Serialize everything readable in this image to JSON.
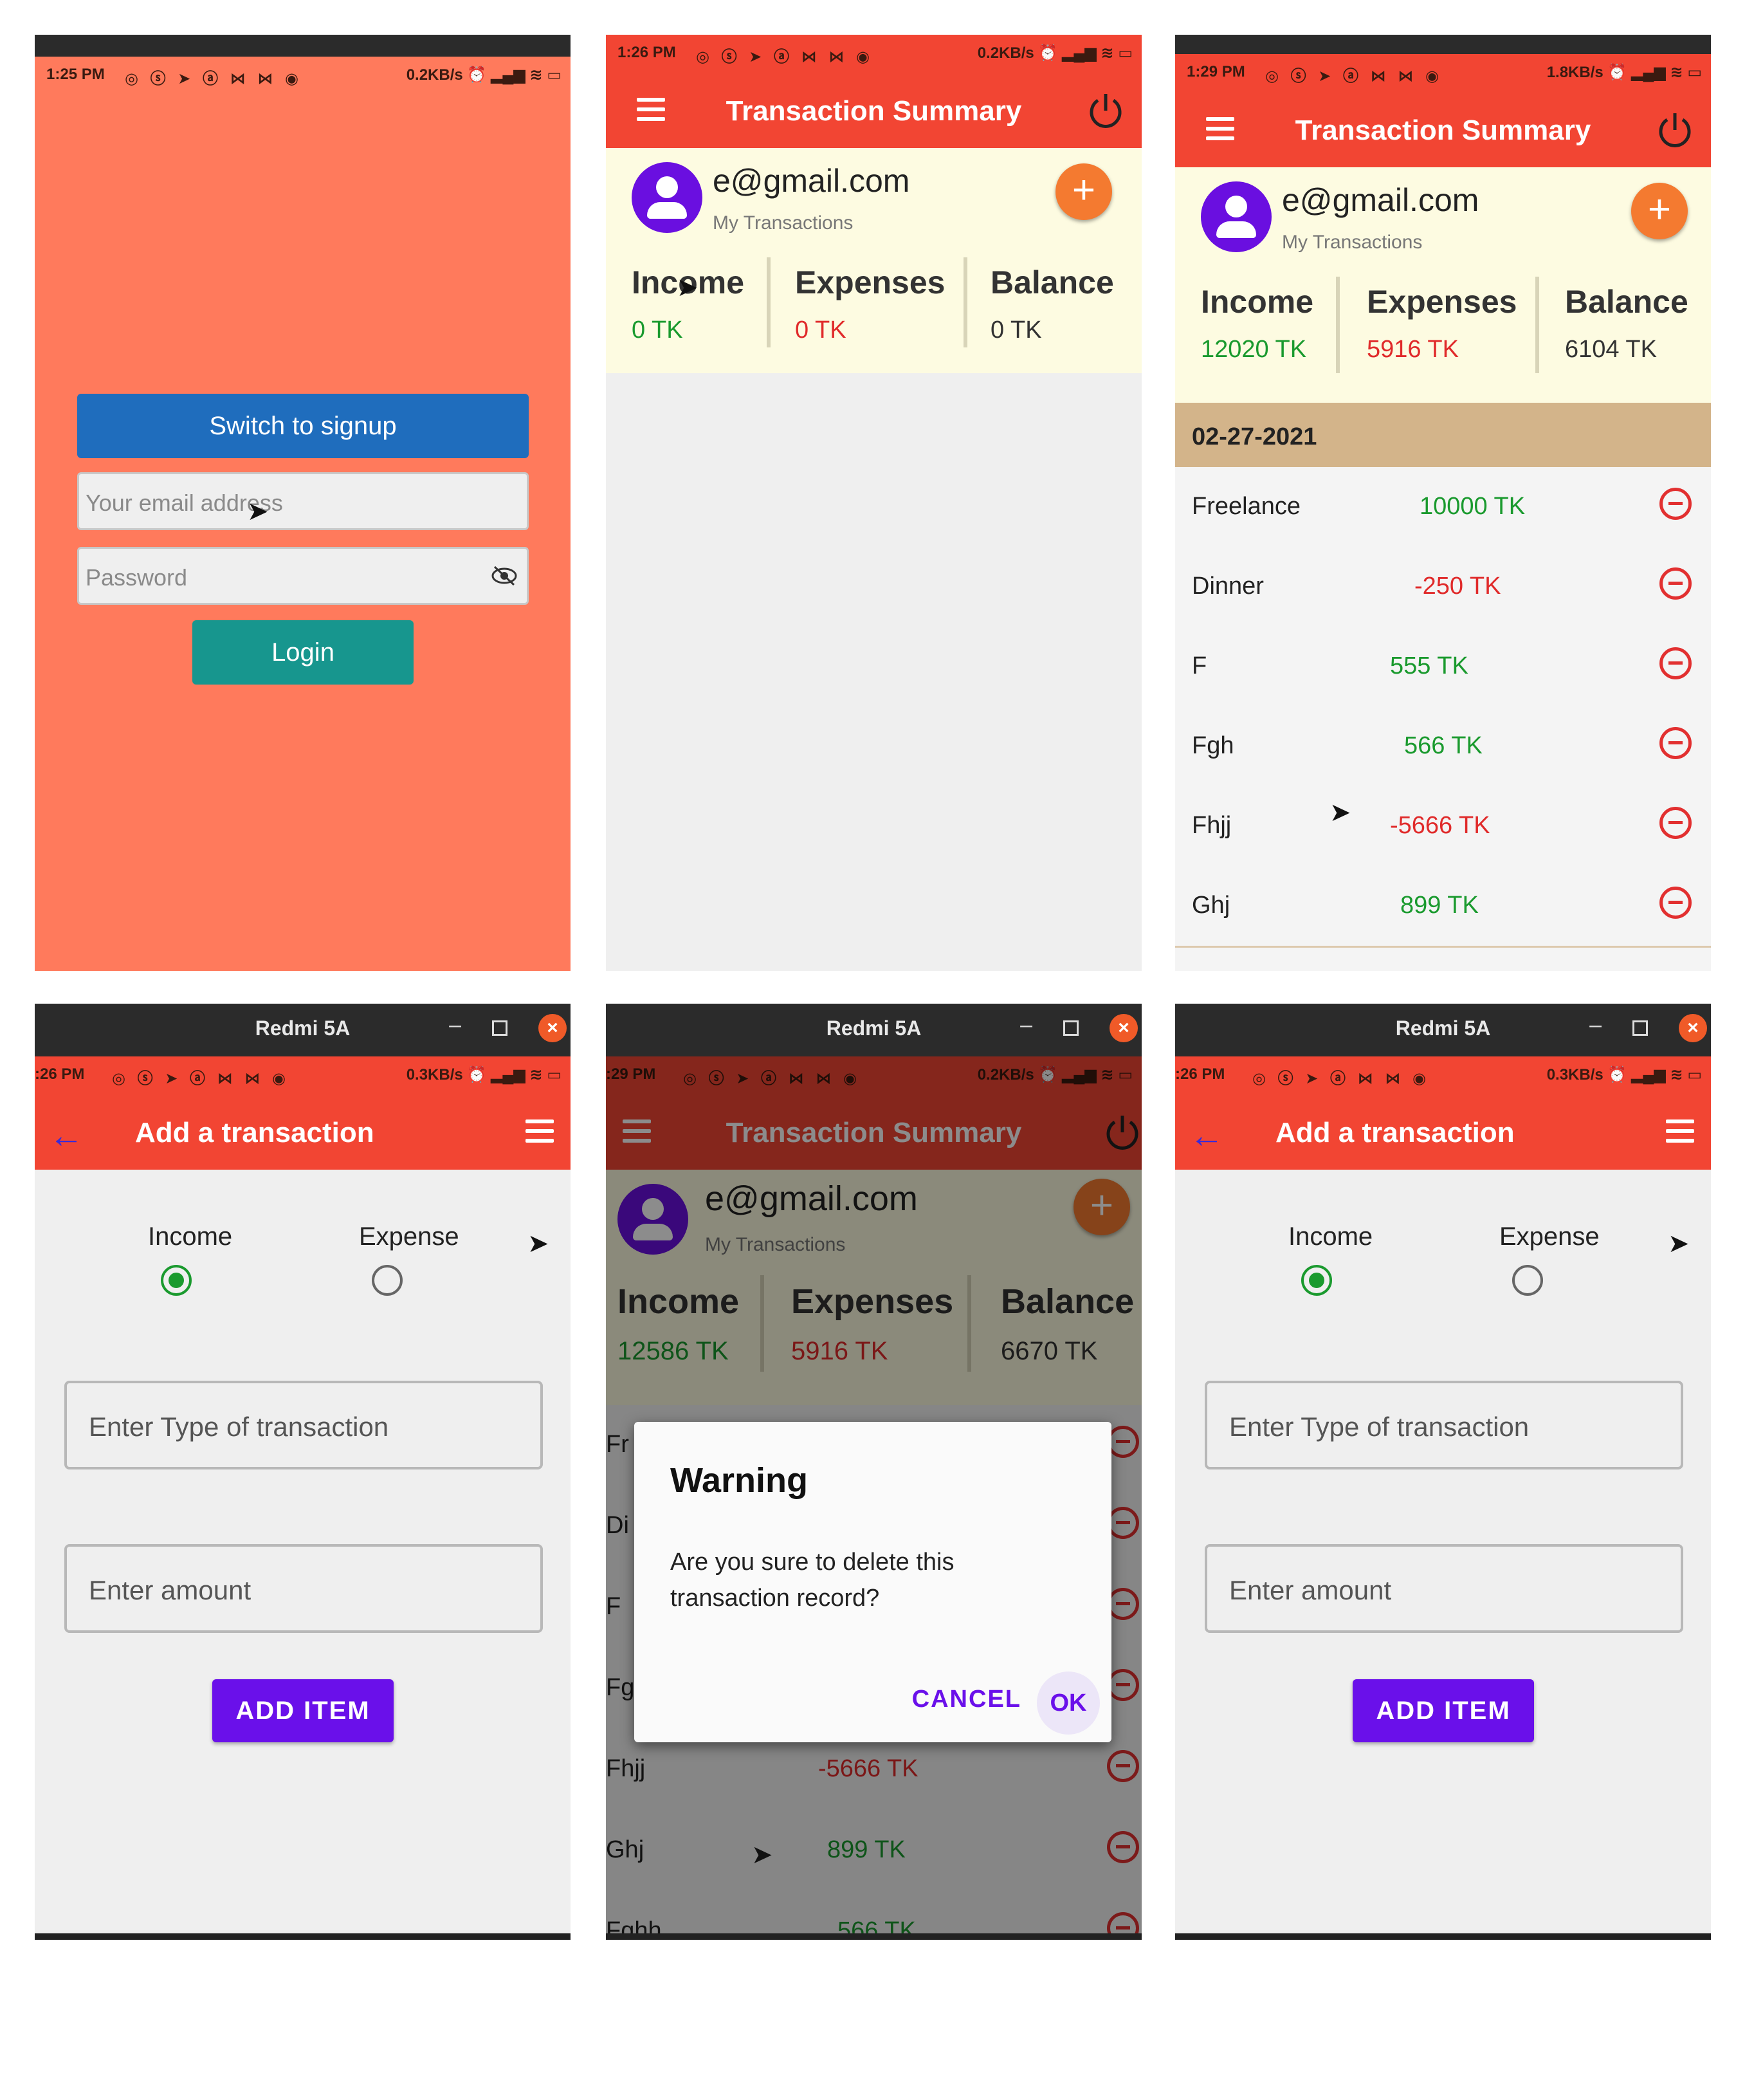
{
  "status": {
    "p1_time": "1:25 PM",
    "p1_speed": "0.2KB/s",
    "p2_time": "1:26 PM",
    "p2_speed": "0.2KB/s",
    "p3_time": "1:29 PM",
    "p3_speed": "1.8KB/s",
    "p4_time": ":26 PM",
    "p4_speed": "0.3KB/s",
    "p5_time": ":29 PM",
    "p5_speed": "0.2KB/s",
    "p6_time": ":26 PM",
    "p6_speed": "0.3KB/s",
    "icons": "◎ ⓢ ➤ ⓐ ⋈ ⋈ ◉",
    "right_icons": "⏰ ▂▄▆ ≋ ▭"
  },
  "window": {
    "title": "Redmi 5A",
    "min": "–",
    "close": "×"
  },
  "login": {
    "switch_label": "Switch to signup",
    "email_placeholder": "Your email address",
    "password_placeholder": "Password",
    "login_label": "Login"
  },
  "summary": {
    "title": "Transaction Summary",
    "email": "e@gmail.com",
    "subtitle": "My Transactions",
    "fab": "+",
    "income_label": "Income",
    "expenses_label": "Expenses",
    "balance_label": "Balance",
    "empty": {
      "income": "0 TK",
      "expenses": "0 TK",
      "balance": "0 TK"
    },
    "filled": {
      "income": "12020 TK",
      "expenses": "5916 TK",
      "balance": "6104 TK"
    },
    "dialog_state": {
      "income": "12586 TK",
      "expenses": "5916 TK",
      "balance": "6670 TK"
    }
  },
  "list": {
    "date": "02-27-2021",
    "rows": [
      {
        "name": "Freelance",
        "amount": "10000 TK",
        "color": "#1a9a2e"
      },
      {
        "name": "Dinner",
        "amount": "-250 TK",
        "color": "#e02a2a"
      },
      {
        "name": "F",
        "amount": "555 TK",
        "color": "#1a9a2e"
      },
      {
        "name": "Fgh",
        "amount": "566 TK",
        "color": "#1a9a2e"
      },
      {
        "name": "Fhjj",
        "amount": "-5666 TK",
        "color": "#e02a2a"
      },
      {
        "name": "Ghj",
        "amount": "899 TK",
        "color": "#1a9a2e"
      }
    ],
    "dialog_rows": [
      {
        "name": "Fr",
        "amount": ""
      },
      {
        "name": "Di",
        "amount": ""
      },
      {
        "name": "F",
        "amount": ""
      },
      {
        "name": "Fg",
        "amount": ""
      },
      {
        "name": "Fhjj",
        "amount": "-5666 TK"
      },
      {
        "name": "Ghj",
        "amount": "899 TK"
      },
      {
        "name": "Fghh",
        "amount": "566 TK"
      }
    ]
  },
  "add": {
    "title": "Add a transaction",
    "back": "←",
    "income": "Income",
    "expense": "Expense",
    "type_placeholder": "Enter Type of transaction",
    "amount_placeholder": "Enter amount",
    "add_label": "ADD ITEM"
  },
  "dialog": {
    "title": "Warning",
    "message": "Are you sure to delete this transaction record?",
    "cancel": "CANCEL",
    "ok": "OK"
  },
  "colors": {
    "app_bar": "#f24533",
    "login_bg": "#ff7a5c",
    "accent": "#6a10ea",
    "income": "#1a9a2e",
    "expense": "#e02a2a"
  }
}
